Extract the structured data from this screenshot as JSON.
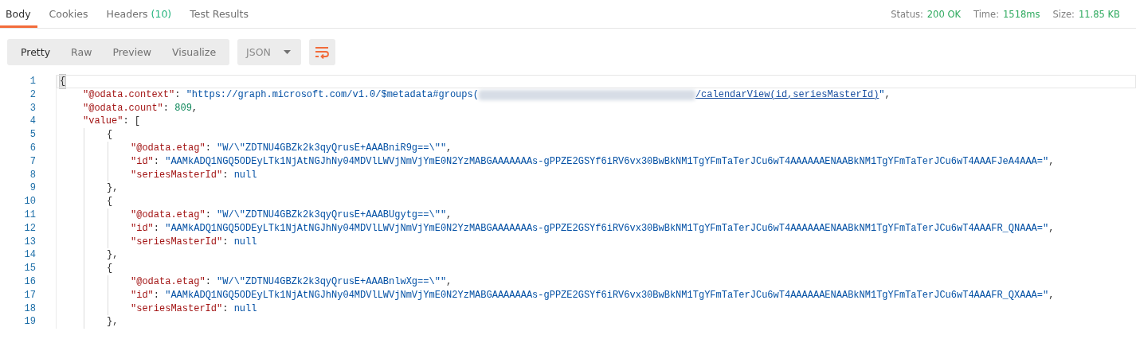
{
  "tabs": [
    {
      "label": "Body",
      "selected": true
    },
    {
      "label": "Cookies",
      "selected": false
    },
    {
      "label": "Headers",
      "count": "(10)",
      "selected": false
    },
    {
      "label": "Test Results",
      "selected": false
    }
  ],
  "status": [
    {
      "label": "Status:",
      "value": "200 OK"
    },
    {
      "label": "Time:",
      "value": "1518ms"
    },
    {
      "label": "Size:",
      "value": "11.85 KB"
    }
  ],
  "view_modes": [
    {
      "label": "Pretty",
      "selected": true
    },
    {
      "label": "Raw",
      "selected": false
    },
    {
      "label": "Preview",
      "selected": false
    },
    {
      "label": "Visualize",
      "selected": false
    }
  ],
  "format_dropdown": {
    "value": "JSON"
  },
  "editor": {
    "lines": [
      {
        "number": "1",
        "active": true,
        "tokens": [
          {
            "kind": "punct",
            "text": "{"
          }
        ],
        "children": [
          {
            "number": "2",
            "active": false,
            "tokens": [
              {
                "kind": "key",
                "text": "\"@odata.context\""
              },
              {
                "kind": "punct",
                "text": ": "
              },
              {
                "kind": "string",
                "text": "\"https://graph.microsoft.com/v1.0/$metadata#groups("
              },
              {
                "kind": "redacted"
              },
              {
                "kind": "link",
                "text": "/calendarView(id,seriesMasterId)"
              },
              {
                "kind": "string",
                "text": "\""
              },
              {
                "kind": "punct",
                "text": ","
              }
            ]
          },
          {
            "number": "3",
            "active": false,
            "tokens": [
              {
                "kind": "key",
                "text": "\"@odata.count\""
              },
              {
                "kind": "punct",
                "text": ": "
              },
              {
                "kind": "number",
                "text": "809"
              },
              {
                "kind": "punct",
                "text": ","
              }
            ]
          },
          {
            "number": "4",
            "active": false,
            "tokens": [
              {
                "kind": "key",
                "text": "\"value\""
              },
              {
                "kind": "punct",
                "text": ": ["
              }
            ],
            "children": [
              {
                "number": "5",
                "active": false,
                "tokens": [
                  {
                    "kind": "punct",
                    "text": "{"
                  }
                ],
                "children": [
                  {
                    "number": "6",
                    "active": false,
                    "tokens": [
                      {
                        "kind": "key",
                        "text": "\"@odata.etag\""
                      },
                      {
                        "kind": "punct",
                        "text": ": "
                      },
                      {
                        "kind": "string",
                        "text": "\"W/\\\"ZDTNU4GBZk2k3qyQrusE+AAABniR9g==\\\"\""
                      },
                      {
                        "kind": "punct",
                        "text": ","
                      }
                    ]
                  },
                  {
                    "number": "7",
                    "active": false,
                    "tokens": [
                      {
                        "kind": "key",
                        "text": "\"id\""
                      },
                      {
                        "kind": "punct",
                        "text": ": "
                      },
                      {
                        "kind": "string",
                        "text": "\"AAMkADQ1NGQ5ODEyLTk1NjAtNGJhNy04MDVlLWVjNmVjYmE0N2YzMABGAAAAAAAs-gPPZE2GSYf6iRV6vx30BwBkNM1TgYFmTaTerJCu6wT4AAAAAAENAABkNM1TgYFmTaTerJCu6wT4AAAFJeA4AAA=\""
                      },
                      {
                        "kind": "punct",
                        "text": ","
                      }
                    ]
                  },
                  {
                    "number": "8",
                    "active": false,
                    "tokens": [
                      {
                        "kind": "key",
                        "text": "\"seriesMasterId\""
                      },
                      {
                        "kind": "punct",
                        "text": ": "
                      },
                      {
                        "kind": "null",
                        "text": "null"
                      }
                    ]
                  }
                ]
              },
              {
                "number": "9",
                "active": false,
                "tokens": [
                  {
                    "kind": "punct",
                    "text": "},"
                  }
                ]
              },
              {
                "number": "10",
                "active": false,
                "tokens": [
                  {
                    "kind": "punct",
                    "text": "{"
                  }
                ],
                "children": [
                  {
                    "number": "11",
                    "active": false,
                    "tokens": [
                      {
                        "kind": "key",
                        "text": "\"@odata.etag\""
                      },
                      {
                        "kind": "punct",
                        "text": ": "
                      },
                      {
                        "kind": "string",
                        "text": "\"W/\\\"ZDTNU4GBZk2k3qyQrusE+AAABUgytg==\\\"\""
                      },
                      {
                        "kind": "punct",
                        "text": ","
                      }
                    ]
                  },
                  {
                    "number": "12",
                    "active": false,
                    "tokens": [
                      {
                        "kind": "key",
                        "text": "\"id\""
                      },
                      {
                        "kind": "punct",
                        "text": ": "
                      },
                      {
                        "kind": "string",
                        "text": "\"AAMkADQ1NGQ5ODEyLTk1NjAtNGJhNy04MDVlLWVjNmVjYmE0N2YzMABGAAAAAAAs-gPPZE2GSYf6iRV6vx30BwBkNM1TgYFmTaTerJCu6wT4AAAAAAENAABkNM1TgYFmTaTerJCu6wT4AAAFR_QNAAA=\""
                      },
                      {
                        "kind": "punct",
                        "text": ","
                      }
                    ]
                  },
                  {
                    "number": "13",
                    "active": false,
                    "tokens": [
                      {
                        "kind": "key",
                        "text": "\"seriesMasterId\""
                      },
                      {
                        "kind": "punct",
                        "text": ": "
                      },
                      {
                        "kind": "null",
                        "text": "null"
                      }
                    ]
                  }
                ]
              },
              {
                "number": "14",
                "active": false,
                "tokens": [
                  {
                    "kind": "punct",
                    "text": "},"
                  }
                ]
              },
              {
                "number": "15",
                "active": false,
                "tokens": [
                  {
                    "kind": "punct",
                    "text": "{"
                  }
                ],
                "children": [
                  {
                    "number": "16",
                    "active": false,
                    "tokens": [
                      {
                        "kind": "key",
                        "text": "\"@odata.etag\""
                      },
                      {
                        "kind": "punct",
                        "text": ": "
                      },
                      {
                        "kind": "string",
                        "text": "\"W/\\\"ZDTNU4GBZk2k3qyQrusE+AAABnlwXg==\\\"\""
                      },
                      {
                        "kind": "punct",
                        "text": ","
                      }
                    ]
                  },
                  {
                    "number": "17",
                    "active": false,
                    "tokens": [
                      {
                        "kind": "key",
                        "text": "\"id\""
                      },
                      {
                        "kind": "punct",
                        "text": ": "
                      },
                      {
                        "kind": "string",
                        "text": "\"AAMkADQ1NGQ5ODEyLTk1NjAtNGJhNy04MDVlLWVjNmVjYmE0N2YzMABGAAAAAAAs-gPPZE2GSYf6iRV6vx30BwBkNM1TgYFmTaTerJCu6wT4AAAAAAENAABkNM1TgYFmTaTerJCu6wT4AAAFR_QXAAA=\""
                      },
                      {
                        "kind": "punct",
                        "text": ","
                      }
                    ]
                  },
                  {
                    "number": "18",
                    "active": false,
                    "tokens": [
                      {
                        "kind": "key",
                        "text": "\"seriesMasterId\""
                      },
                      {
                        "kind": "punct",
                        "text": ": "
                      },
                      {
                        "kind": "null",
                        "text": "null"
                      }
                    ]
                  }
                ]
              },
              {
                "number": "19",
                "active": false,
                "tokens": [
                  {
                    "kind": "punct",
                    "text": "},"
                  }
                ]
              }
            ]
          }
        ]
      }
    ]
  }
}
